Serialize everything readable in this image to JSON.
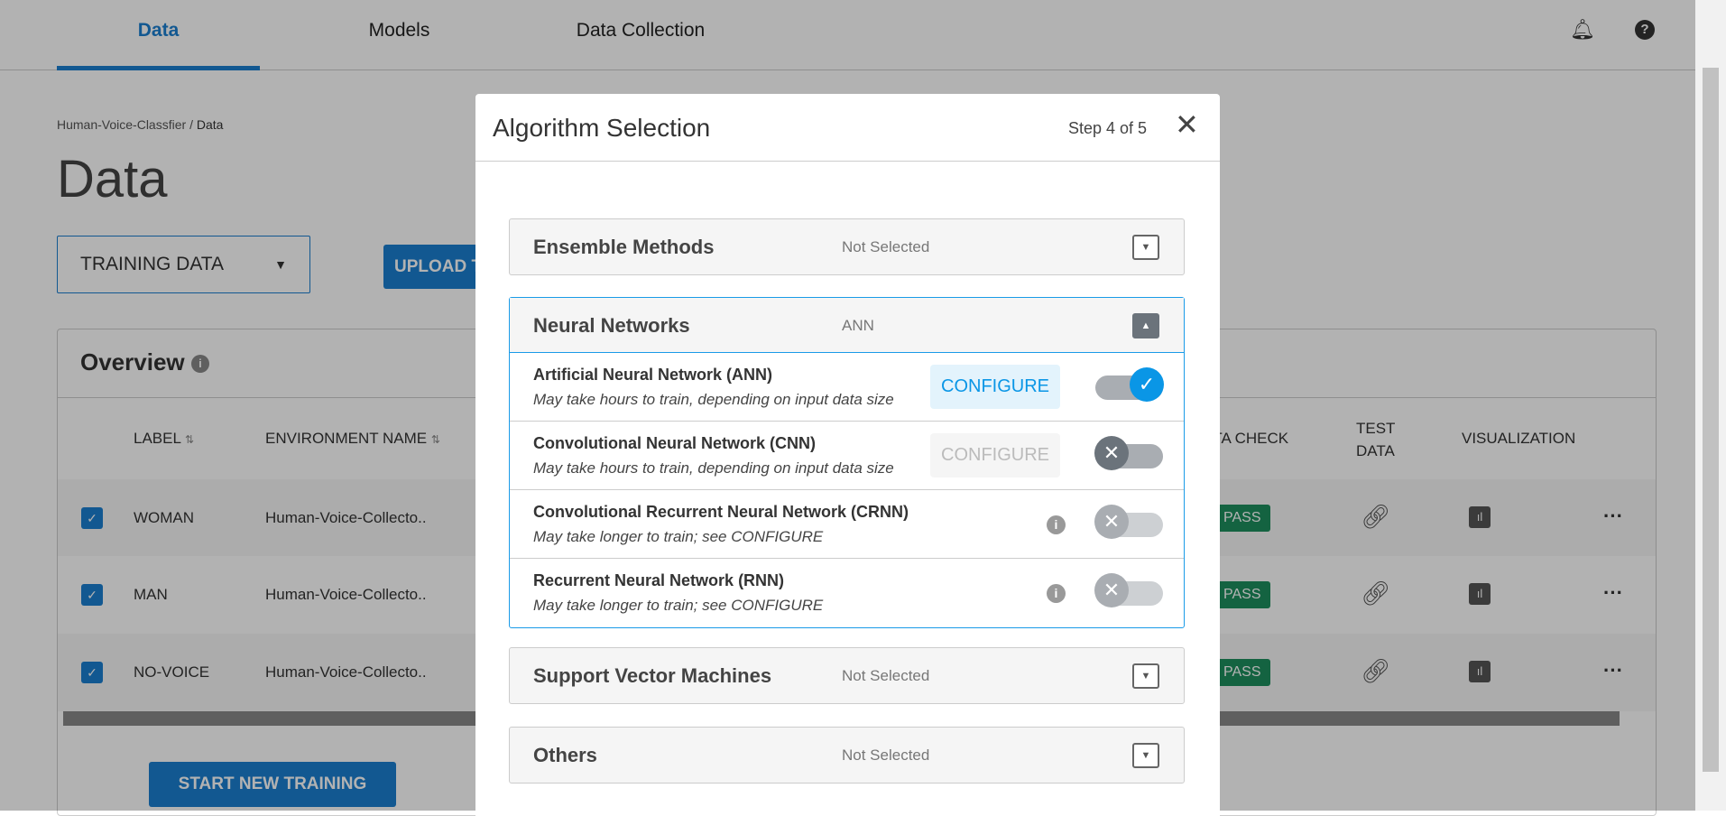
{
  "nav": {
    "tabs": [
      {
        "label": "Data",
        "active": true
      },
      {
        "label": "Models"
      },
      {
        "label": "Data Collection"
      }
    ],
    "icons": [
      "bell-icon",
      "help-icon"
    ]
  },
  "breadcrumb": {
    "parent": "Human-Voice-Classfier",
    "separator": "/",
    "current": "Data"
  },
  "page_title": "Data",
  "dataset_select": {
    "value": "TRAINING DATA"
  },
  "upload_button": "UPLOAD T",
  "overview": {
    "title": "Overview",
    "columns": [
      "LABEL",
      "ENVIRONMENT NAME",
      "DATA CHECK",
      "TEST",
      "DATA",
      "VISUALIZATION"
    ],
    "rows": [
      {
        "label": "WOMAN",
        "environment": "Human-Voice-Collecto..",
        "data_check": "PASS"
      },
      {
        "label": "MAN",
        "environment": "Human-Voice-Collecto..",
        "data_check": "PASS"
      },
      {
        "label": "NO-VOICE",
        "environment": "Human-Voice-Collecto..",
        "data_check": "PASS"
      }
    ]
  },
  "start_button": "START NEW TRAINING",
  "modal": {
    "title": "Algorithm Selection",
    "step": "Step 4 of 5",
    "close": "✕",
    "groups": [
      {
        "title": "Ensemble Methods",
        "status": "Not Selected"
      },
      {
        "title": "Neural Networks",
        "status": "ANN",
        "items": [
          {
            "title": "Artificial Neural Network (ANN)",
            "subtitle": "May take hours to train, depending on input data size",
            "configure": "CONFIGURE",
            "enabled": true
          },
          {
            "title": "Convolutional Neural Network (CNN)",
            "subtitle": "May take hours to train, depending on input data size",
            "configure": "CONFIGURE",
            "enabled": false
          },
          {
            "title": "Convolutional Recurrent Neural Network (CRNN)",
            "subtitle": "May take longer to train; see CONFIGURE",
            "enabled": false
          },
          {
            "title": "Recurrent Neural Network (RNN)",
            "subtitle": "May take longer to train; see CONFIGURE",
            "enabled": false
          }
        ]
      },
      {
        "title": "Support Vector Machines",
        "status": "Not Selected"
      },
      {
        "title": "Others",
        "status": "Not Selected"
      }
    ]
  },
  "colors": {
    "accent": "#1a7fd0",
    "toggle_on": "#0a96e6",
    "pass": "#1e8f5e"
  }
}
